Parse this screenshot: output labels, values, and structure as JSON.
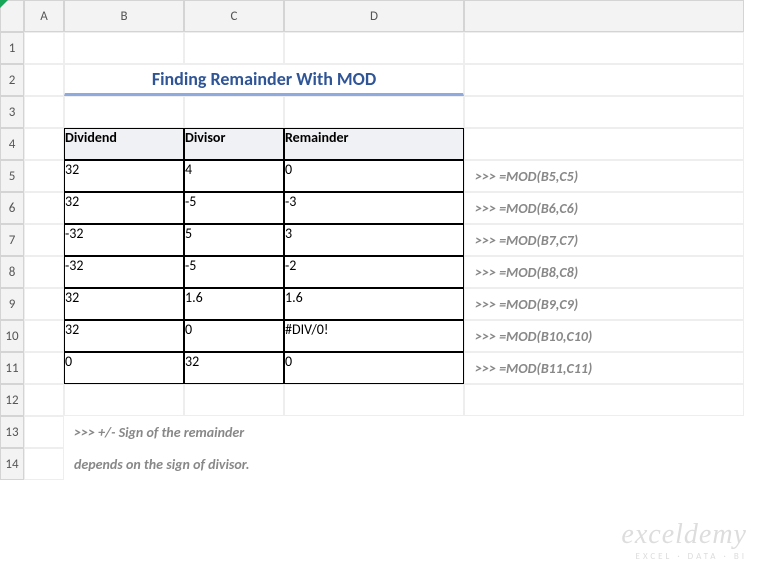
{
  "columns": [
    "A",
    "B",
    "C",
    "D"
  ],
  "rows": [
    "1",
    "2",
    "3",
    "4",
    "5",
    "6",
    "7",
    "8",
    "9",
    "10",
    "11",
    "12",
    "13",
    "14"
  ],
  "title": "Finding Remainder With MOD",
  "headers": {
    "dividend": "Dividend",
    "divisor": "Divisor",
    "remainder": "Remainder"
  },
  "data": [
    {
      "dividend": "32",
      "divisor": "4",
      "remainder": "0",
      "formula": ">>> =MOD(B5,C5)"
    },
    {
      "dividend": "32",
      "divisor": "-5",
      "remainder": "-3",
      "formula": ">>> =MOD(B6,C6)"
    },
    {
      "dividend": "-32",
      "divisor": "5",
      "remainder": "3",
      "formula": ">>> =MOD(B7,C7)"
    },
    {
      "dividend": "-32",
      "divisor": "-5",
      "remainder": "-2",
      "formula": ">>> =MOD(B8,C8)"
    },
    {
      "dividend": "32",
      "divisor": "1.6",
      "remainder": "1.6",
      "formula": ">>> =MOD(B9,C9)"
    },
    {
      "dividend": "32",
      "divisor": "0",
      "remainder": "#DIV/0!",
      "formula": ">>> =MOD(B10,C10)"
    },
    {
      "dividend": "0",
      "divisor": "32",
      "remainder": "0",
      "formula": ">>> =MOD(B11,C11)"
    }
  ],
  "note_line1": ">>> +/- Sign of the remainder",
  "note_line2": "depends on the sign of divisor.",
  "watermark": {
    "brand": "exceldemy",
    "tagline": "EXCEL · DATA · BI"
  }
}
